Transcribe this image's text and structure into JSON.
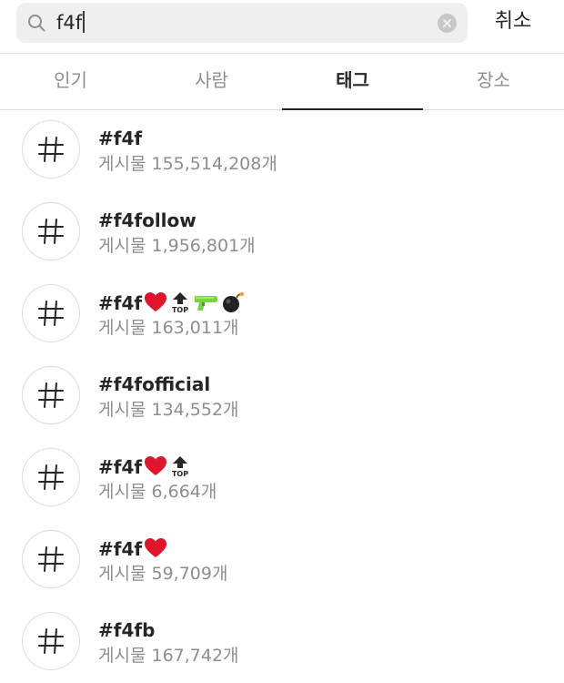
{
  "search": {
    "query": "f4f",
    "cancel_label": "취소"
  },
  "tabs": [
    {
      "label": "인기",
      "active": false
    },
    {
      "label": "사람",
      "active": false
    },
    {
      "label": "태그",
      "active": true
    },
    {
      "label": "장소",
      "active": false
    }
  ],
  "results": [
    {
      "tag": "#f4f",
      "count": "게시물 155,514,208개",
      "emojis": []
    },
    {
      "tag": "#f4follow",
      "count": "게시물 1,956,801개",
      "emojis": []
    },
    {
      "tag": "#f4f",
      "count": "게시물 163,011개",
      "emojis": [
        "heart-emoji",
        "top-arrow-emoji",
        "water-gun-emoji",
        "bomb-emoji"
      ]
    },
    {
      "tag": "#f4fofficial",
      "count": "게시물 134,552개",
      "emojis": []
    },
    {
      "tag": "#f4f",
      "count": "게시물 6,664개",
      "emojis": [
        "heart-emoji",
        "top-arrow-emoji"
      ]
    },
    {
      "tag": "#f4f",
      "count": "게시물 59,709개",
      "emojis": [
        "heart-emoji"
      ]
    },
    {
      "tag": "#f4fb",
      "count": "게시물 167,742개",
      "emojis": []
    }
  ],
  "colors": {
    "text": "#262626",
    "secondary_text": "#8e8e8e",
    "search_bg": "#efefef",
    "divider": "#dbdbdb"
  }
}
